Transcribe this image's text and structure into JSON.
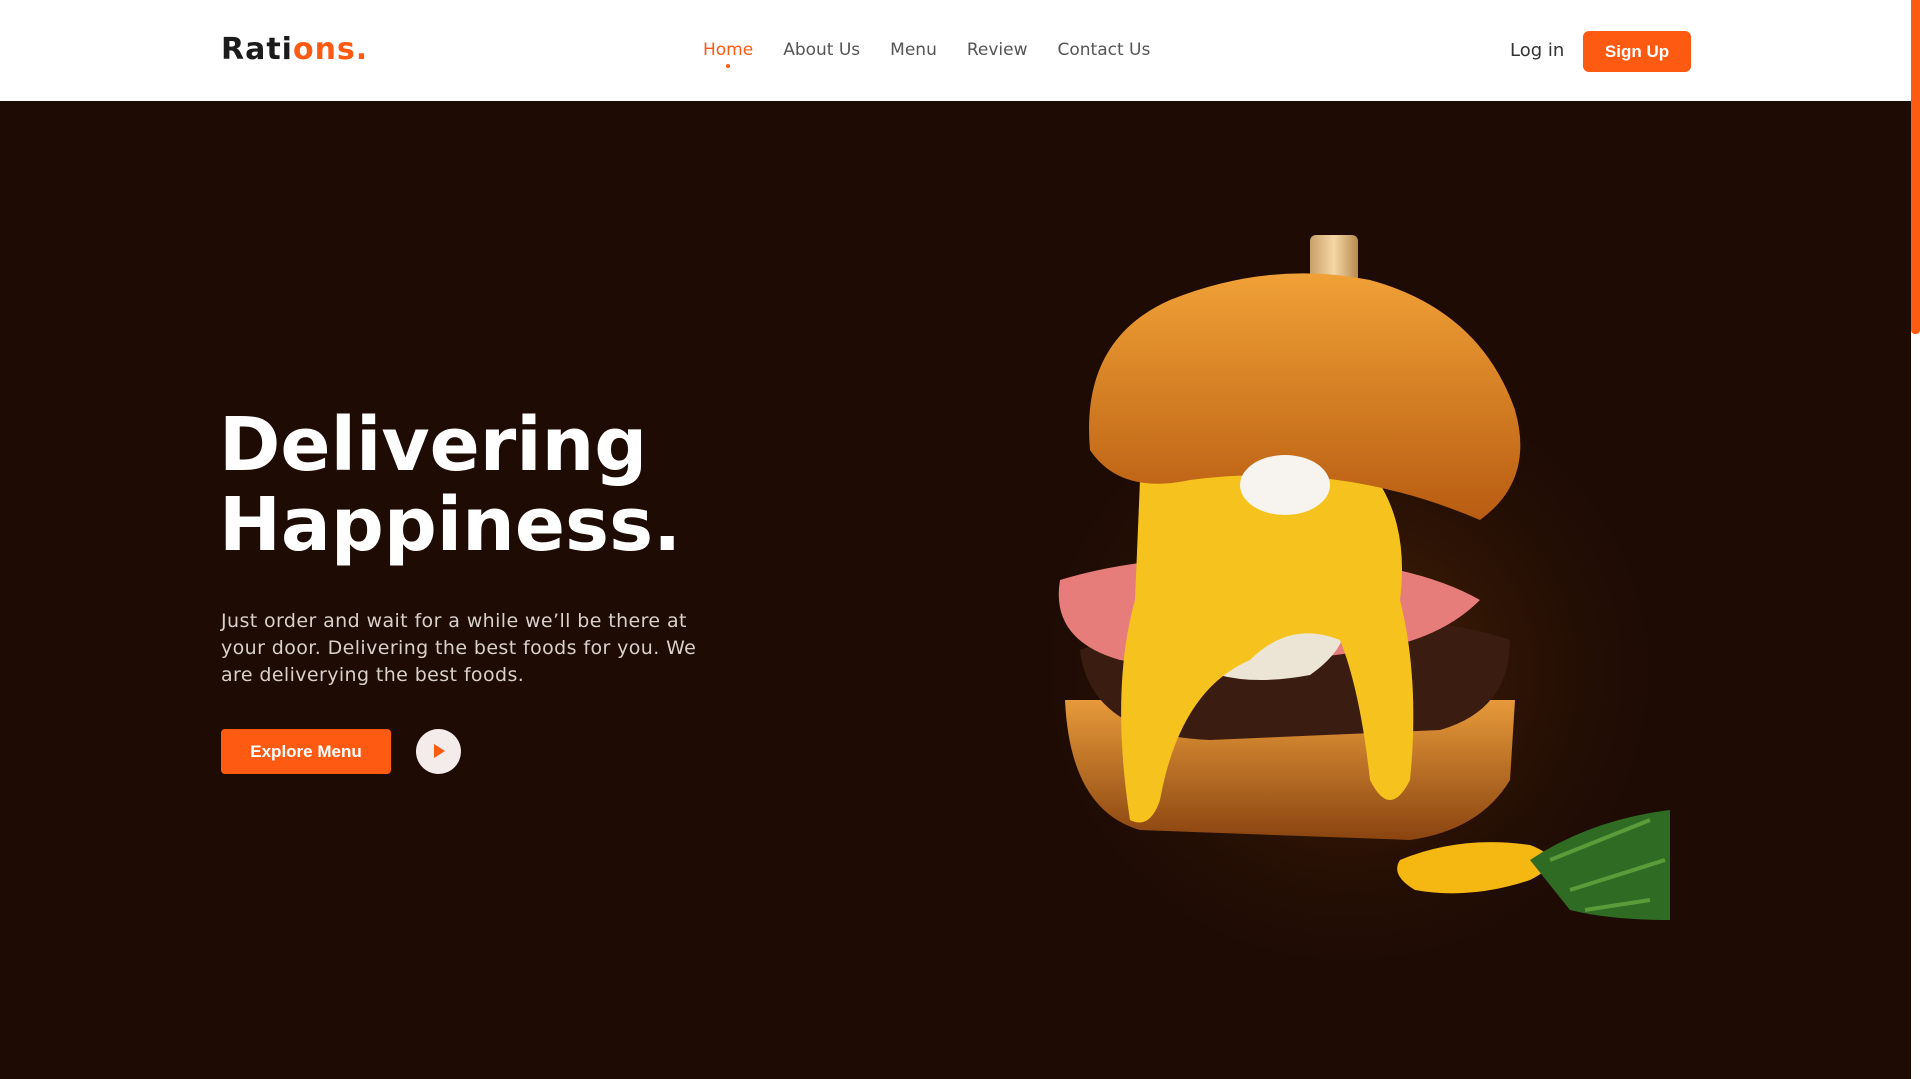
{
  "brand": {
    "logo_main": "Rati",
    "logo_accent": "ons."
  },
  "nav": {
    "items": [
      {
        "label": "Home",
        "active": true
      },
      {
        "label": "About Us"
      },
      {
        "label": "Menu"
      },
      {
        "label": "Review"
      },
      {
        "label": "Contact Us"
      }
    ]
  },
  "auth": {
    "login_label": "Log in",
    "signup_label": "Sign Up"
  },
  "hero": {
    "title_line1": "Delivering",
    "title_line2": "Happiness.",
    "description": "Just order and wait for a while we’ll be there at your door. Delivering the best foods for you. We are deliverying the best foods.",
    "explore_label": "Explore Menu",
    "play_icon": "play-icon"
  },
  "colors": {
    "accent": "#ff5a12",
    "background": "#1d0b04",
    "header_bg": "#ffffff"
  }
}
